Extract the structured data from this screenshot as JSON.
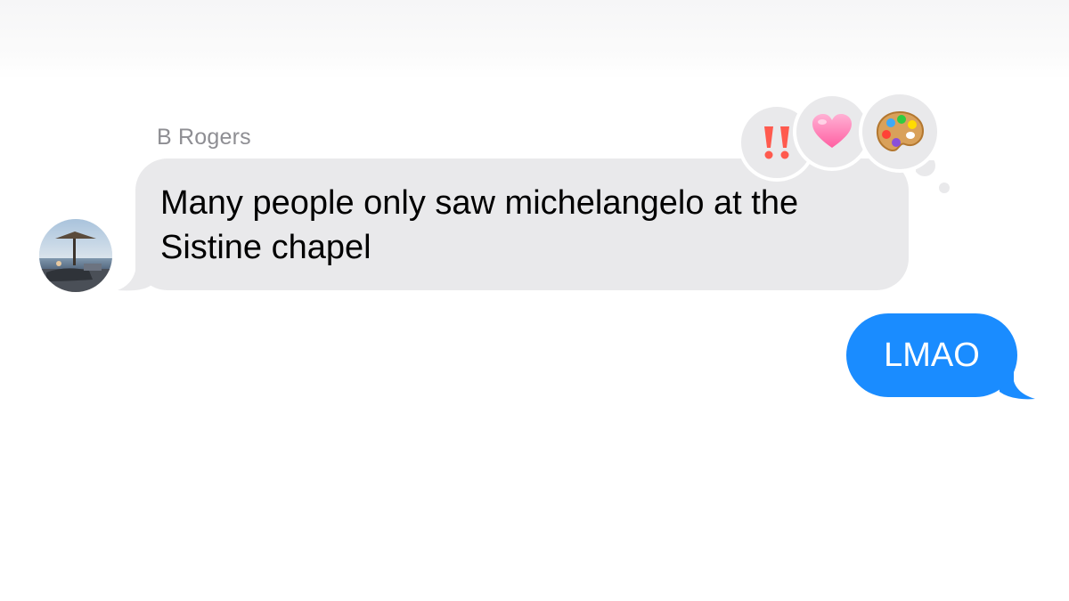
{
  "conversation": {
    "incoming": {
      "sender_name": "B Rogers",
      "message": "Many people only saw michelangelo at the Sistine chapel",
      "bubble_color": "#e9e9eb",
      "reactions": [
        {
          "icon": "double-exclamation-icon"
        },
        {
          "icon": "pink-heart-icon"
        },
        {
          "icon": "artist-palette-icon"
        }
      ]
    },
    "outgoing": {
      "message": "LMAO",
      "bubble_color": "#1a8cff"
    }
  }
}
